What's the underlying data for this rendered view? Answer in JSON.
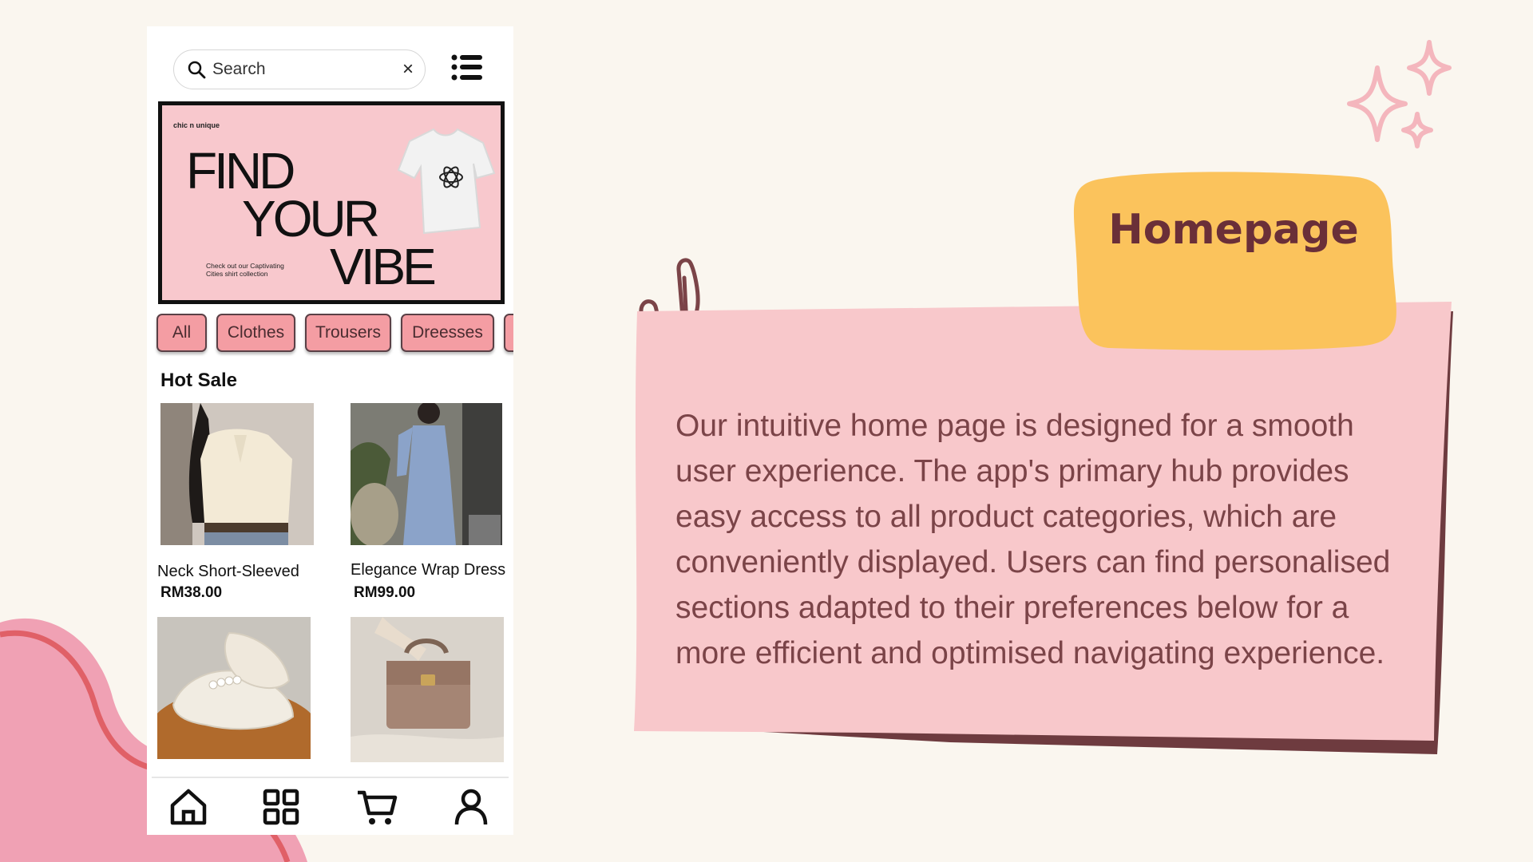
{
  "search": {
    "placeholder": "Search",
    "clear_icon": "×"
  },
  "banner": {
    "brand": "chic n unique",
    "headline_1": "FIND",
    "headline_2": "YOUR",
    "headline_3": "VIBE",
    "subtext": "Check out our Captivating Cities shirt collection"
  },
  "categories": [
    "All",
    "Clothes",
    "Trousers",
    "Dreesses"
  ],
  "section_title": "Hot Sale",
  "products": [
    {
      "name": "Neck Short-Sleeved",
      "price": "RM38.00"
    },
    {
      "name": "Elegance Wrap Dress",
      "price": "RM99.00"
    }
  ],
  "bottom_nav": [
    "home-icon",
    "grid-icon",
    "cart-icon",
    "profile-icon"
  ],
  "panel": {
    "title": "Homepage",
    "description": "Our intuitive home page is designed for a smooth user experience. The app's primary hub provides easy access to all product categories, which are conveniently displayed. Users can find personalised sections adapted to their preferences below for a more efficient and optimised navigating experience."
  },
  "colors": {
    "background": "#faf6ef",
    "card_pink": "#f8c8cb",
    "card_shadow": "#6e3b3f",
    "tag_yellow": "#fbc35c",
    "chip_pink": "#f49da3",
    "text_brown": "#7b4448"
  }
}
